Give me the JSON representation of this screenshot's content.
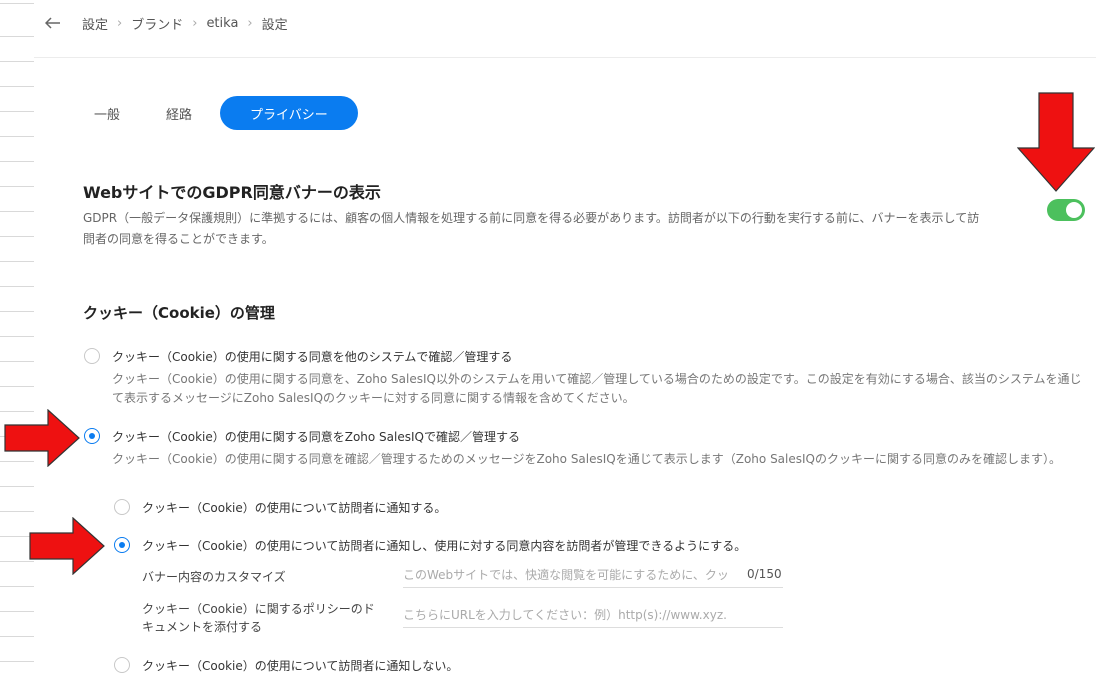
{
  "breadcrumb": [
    "設定",
    "ブランド",
    "etika",
    "設定"
  ],
  "tabs": [
    {
      "label": "一般",
      "active": false
    },
    {
      "label": "経路",
      "active": false
    },
    {
      "label": "プライバシー",
      "active": true
    }
  ],
  "gdpr": {
    "title": "WebサイトでのGDPR同意バナーの表示",
    "description": "GDPR（一般データ保護規則）に準拠するには、顧客の個人情報を処理する前に同意を得る必要があります。訪問者が以下の行動を実行する前に、バナーを表示して訪問者の同意を得ることができます。",
    "enabled": true
  },
  "cookie": {
    "title": "クッキー（Cookie）の管理",
    "option_other": {
      "label": "クッキー（Cookie）の使用に関する同意を他のシステムで確認／管理する",
      "desc": "クッキー（Cookie）の使用に関する同意を、Zoho SalesIQ以外のシステムを用いて確認／管理している場合のための設定です。この設定を有効にする場合、該当のシステムを通じて表示するメッセージにZoho SalesIQのクッキーに対する同意に関する情報を含めてください。"
    },
    "option_salesiq": {
      "label": "クッキー（Cookie）の使用に関する同意をZoho SalesIQで確認／管理する",
      "desc": "クッキー（Cookie）の使用に関する同意を確認／管理するためのメッセージをZoho SalesIQを通じて表示します（Zoho SalesIQのクッキーに関する同意のみを確認します）。"
    },
    "sub_notify": "クッキー（Cookie）の使用について訪問者に通知する。",
    "sub_manage": "クッキー（Cookie）の使用について訪問者に通知し、使用に対する同意内容を訪問者が管理できるようにする。",
    "banner_label": "バナー内容のカスタマイズ",
    "banner_placeholder": "このWebサイトでは、快適な閲覧を可能にするために、クッ",
    "banner_counter": "0/150",
    "policy_label_1": "クッキー（Cookie）に関するポリシーのド",
    "policy_label_2": "キュメントを添付する",
    "policy_placeholder": "こちらにURLを入力してください：例）http(s)://www.xyz.",
    "sub_none": "クッキー（Cookie）の使用について訪問者に通知しない。"
  },
  "colors": {
    "accent": "#0a7cf0",
    "toggle_on": "#4cc05d",
    "annotation_arrow": "#ee1111"
  }
}
